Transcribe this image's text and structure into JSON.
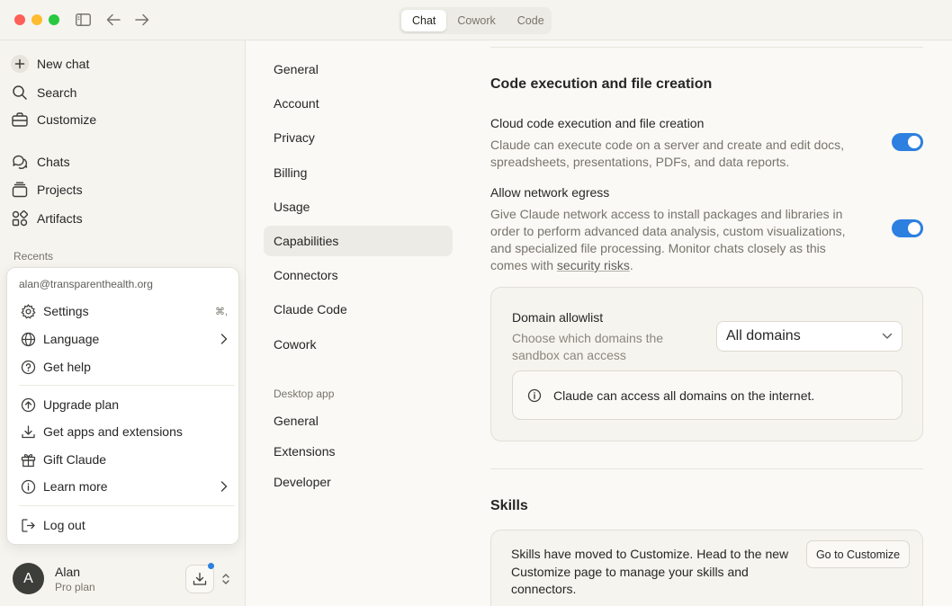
{
  "titlebar": {
    "tabs": [
      {
        "label": "Chat",
        "active": true
      },
      {
        "label": "Cowork",
        "active": false
      },
      {
        "label": "Code",
        "active": false
      }
    ]
  },
  "sidebar": {
    "primary": [
      {
        "label": "New chat",
        "icon": "plus-icon"
      },
      {
        "label": "Search",
        "icon": "search-icon"
      },
      {
        "label": "Customize",
        "icon": "briefcase-icon"
      }
    ],
    "secondary": [
      {
        "label": "Chats",
        "icon": "chat-bubbles-icon"
      },
      {
        "label": "Projects",
        "icon": "folder-stack-icon"
      },
      {
        "label": "Artifacts",
        "icon": "shapes-icon"
      }
    ],
    "recents_label": "Recents"
  },
  "account_menu": {
    "email": "alan@transparenthealth.org",
    "items": [
      {
        "label": "Settings",
        "icon": "gear-icon",
        "shortcut": "⌘,"
      },
      {
        "label": "Language",
        "icon": "globe-icon",
        "submenu": true
      },
      {
        "label": "Get help",
        "icon": "help-icon"
      },
      {
        "label": "Upgrade plan",
        "icon": "arrow-up-circle-icon"
      },
      {
        "label": "Get apps and extensions",
        "icon": "download-icon"
      },
      {
        "label": "Gift Claude",
        "icon": "gift-icon"
      },
      {
        "label": "Learn more",
        "icon": "info-icon",
        "submenu": true
      },
      {
        "label": "Log out",
        "icon": "logout-icon"
      }
    ]
  },
  "user": {
    "initial": "A",
    "name": "Alan",
    "plan": "Pro plan"
  },
  "settings_nav": {
    "items": [
      "General",
      "Account",
      "Privacy",
      "Billing",
      "Usage",
      "Capabilities",
      "Connectors",
      "Claude Code",
      "Cowork"
    ],
    "active": "Capabilities",
    "desktop_section_label": "Desktop app",
    "desktop_items": [
      "General",
      "Extensions",
      "Developer"
    ]
  },
  "capabilities": {
    "section_title": "Code execution and file creation",
    "cloud_exec": {
      "title": "Cloud code execution and file creation",
      "description": "Claude can execute code on a server and create and edit docs, spreadsheets, presentations, PDFs, and data reports.",
      "enabled": true
    },
    "network_egress": {
      "title": "Allow network egress",
      "description": "Give Claude network access to install packages and libraries in order to perform advanced data analysis, custom visualizations, and specialized file processing. Monitor chats closely as this comes with",
      "link_text": "security risks",
      "trailing": ".",
      "enabled": true
    },
    "domain_allowlist": {
      "title": "Domain allowlist",
      "description": "Choose which domains the sandbox can access",
      "selected": "All domains",
      "info": "Claude can access all domains on the internet."
    }
  },
  "skills": {
    "title": "Skills",
    "text": "Skills have moved to Customize. Head to the new Customize page to manage your skills and connectors.",
    "button": "Go to Customize"
  },
  "colors": {
    "accent": "#2d7fe0",
    "background": "#faf9f5",
    "sidebar": "#f5f4ef"
  }
}
